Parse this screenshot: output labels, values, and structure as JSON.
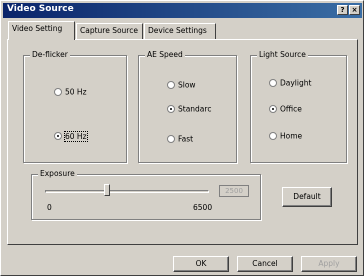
{
  "window": {
    "title": "Video Source"
  },
  "titlebar_buttons": {
    "help": "?",
    "close": "×"
  },
  "tabs": [
    {
      "label": "Video Setting",
      "active": true
    },
    {
      "label": "Capture Source",
      "active": false
    },
    {
      "label": "Device Settings",
      "active": false
    }
  ],
  "deflicker": {
    "legend": "De-flicker",
    "options": [
      {
        "label": "50 Hz",
        "selected": false
      },
      {
        "label": "60 Hz",
        "selected": true
      }
    ]
  },
  "ae_speed": {
    "legend": "AE Speed",
    "options": [
      {
        "label": "Slow",
        "selected": false
      },
      {
        "label": "Standarc",
        "selected": true
      },
      {
        "label": "Fast",
        "selected": false
      }
    ]
  },
  "light_source": {
    "legend": "Light Source",
    "options": [
      {
        "label": "Daylight",
        "selected": false
      },
      {
        "label": "Office",
        "selected": true
      },
      {
        "label": "Home",
        "selected": false
      }
    ]
  },
  "exposure": {
    "legend": "Exposure",
    "min_label": "0",
    "max_label": "6500",
    "value": "2500",
    "slider_fraction": 0.38
  },
  "buttons": {
    "default": "Default",
    "ok": "OK",
    "cancel": "Cancel",
    "apply": "Apply"
  }
}
